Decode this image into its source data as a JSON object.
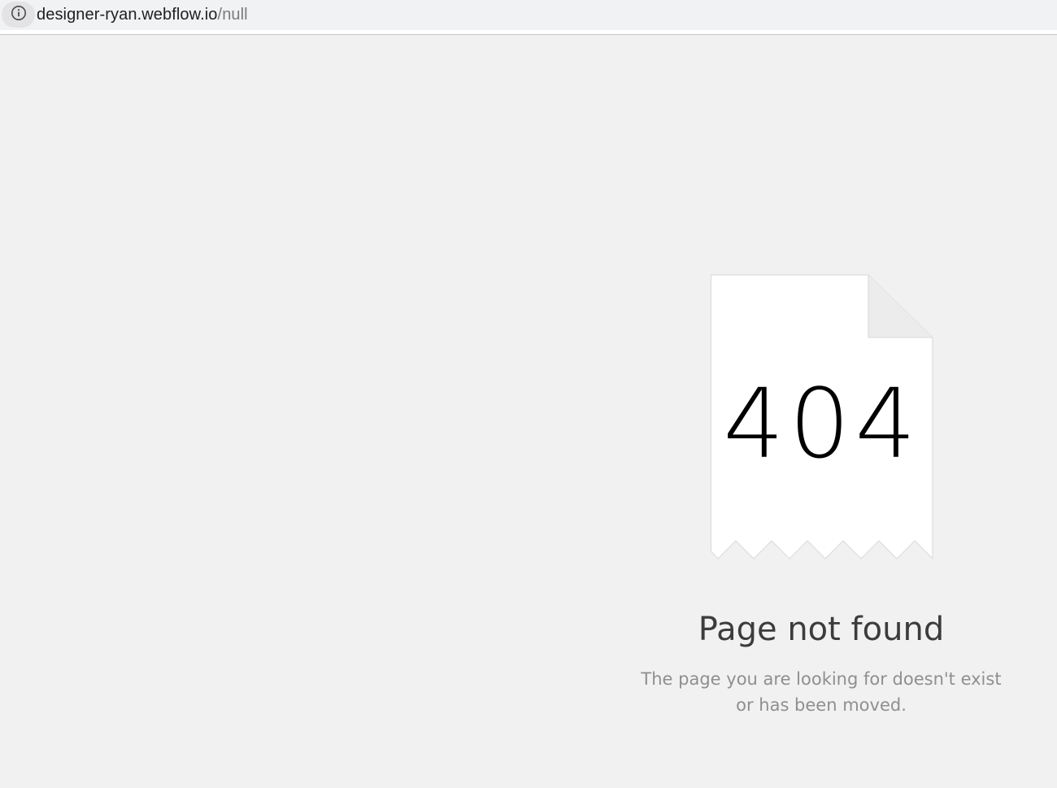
{
  "browser": {
    "url_host": "designer-ryan.webflow.io",
    "url_path": "/null",
    "info_icon": "info-icon"
  },
  "error_page": {
    "code": "404",
    "title": "Page not found",
    "message": "The page you are looking for doesn't exist or has been moved.",
    "illustration_icon": "torn-document-icon"
  },
  "colors": {
    "page_background": "#f1f1f1",
    "paper": "#ffffff",
    "paper_border": "#dddddd",
    "title_text": "#3c3c3c",
    "message_text": "#8f8f8f"
  }
}
